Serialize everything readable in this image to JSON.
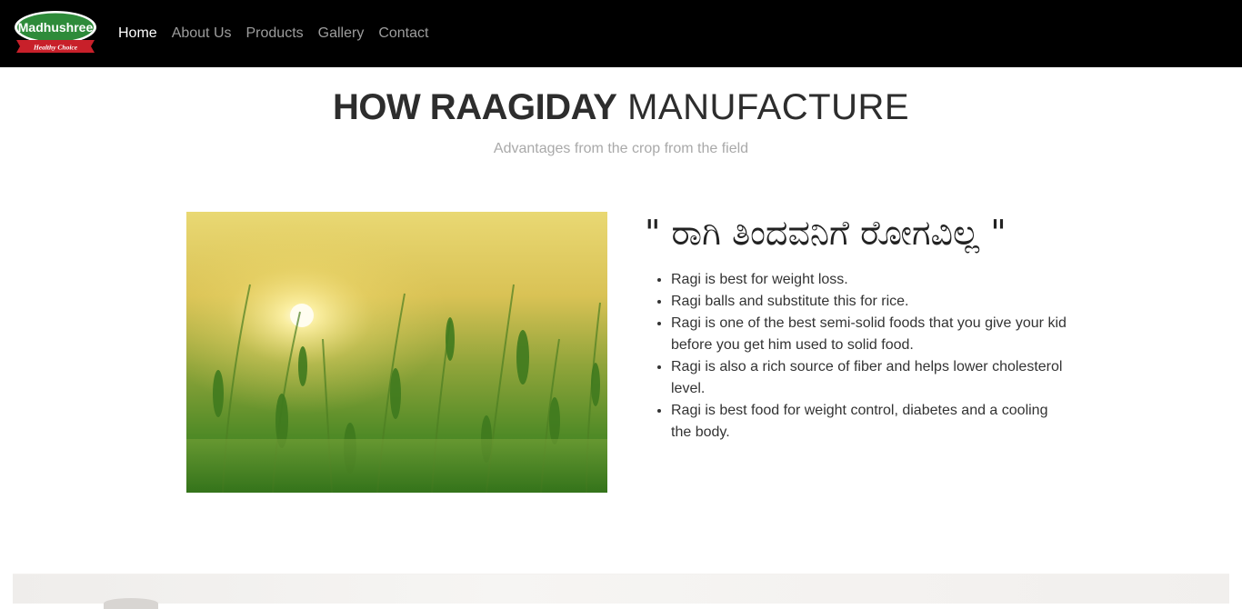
{
  "brand": {
    "name": "Madhushree",
    "tagline": "Healthy Choice",
    "colors": {
      "green": "#2e8b3a",
      "red": "#c8202a",
      "white": "#ffffff"
    }
  },
  "nav": {
    "items": [
      {
        "label": "Home",
        "active": true
      },
      {
        "label": "About Us",
        "active": false
      },
      {
        "label": "Products",
        "active": false
      },
      {
        "label": "Gallery",
        "active": false
      },
      {
        "label": "Contact",
        "active": false
      }
    ]
  },
  "section": {
    "title_bold": "HOW RAAGIDAY",
    "title_light": "MANUFACTURE",
    "subtitle": "Advantages from the crop from the field"
  },
  "quote": "\" ರಾಗಿ ತಿಂದವನಿಗೆ ರೋಗವಿಲ್ಲ \"",
  "benefits": [
    "Ragi is best for weight loss.",
    "Ragi balls and substitute this for rice.",
    "Ragi is one of the best semi-solid foods that you give your kid before you get him used to solid food.",
    "Ragi is also a rich source of fiber and helps lower cholesterol level.",
    "Ragi is best food for weight control, diabetes and a cooling the body."
  ],
  "colors": {
    "navbar_bg": "#000000",
    "nav_active": "#ffffff",
    "nav_inactive": "#9d9d9d",
    "heading": "#2d2d2d",
    "subheading": "#a9a9a9"
  }
}
